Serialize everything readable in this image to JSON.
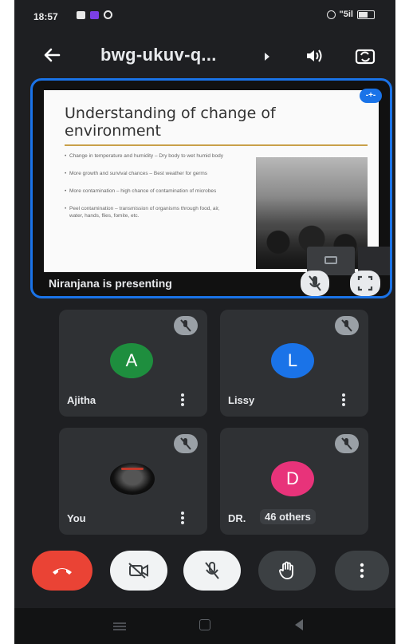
{
  "status_bar": {
    "time": "18:57",
    "signal_text": "\"5il",
    "icons": [
      "message-icon",
      "app-icon",
      "sync-icon",
      "alarm-icon",
      "signal-icon",
      "battery-icon"
    ]
  },
  "top_bar": {
    "back_icon": "arrow-left-icon",
    "meeting_code": "bwg-ukuv-q...",
    "audio_icon": "speaker-icon",
    "flip_icon": "switch-camera-icon"
  },
  "presentation": {
    "slide_title": "Understanding of change of environment",
    "bullets": [
      "Change in temperature and humidity – Dry body to wet humid body",
      "More growth and survival chances – Best weather for germs",
      "More contamination – high chance of contamination of microbes",
      "Peel contamination – transmission of organisms through food, air, water, hands, flies, fomite, etc."
    ],
    "presenter_label": "Niranjana is presenting",
    "pin_badge": "-+-"
  },
  "participants": [
    {
      "name": "Ajitha",
      "initial": "A",
      "color": "#1e8e3e"
    },
    {
      "name": "Lissy",
      "initial": "L",
      "color": "#1a73e8"
    },
    {
      "name": "You",
      "initial": "",
      "color": "#000000"
    },
    {
      "name": "DR.",
      "initial": "D",
      "color": "#e8337a",
      "others": "46 others"
    }
  ],
  "controls": {
    "end_call_color": "#ea4335",
    "icons": [
      "end-call-icon",
      "camera-off-icon",
      "mic-off-icon",
      "raise-hand-icon",
      "more-vertical-icon"
    ]
  }
}
